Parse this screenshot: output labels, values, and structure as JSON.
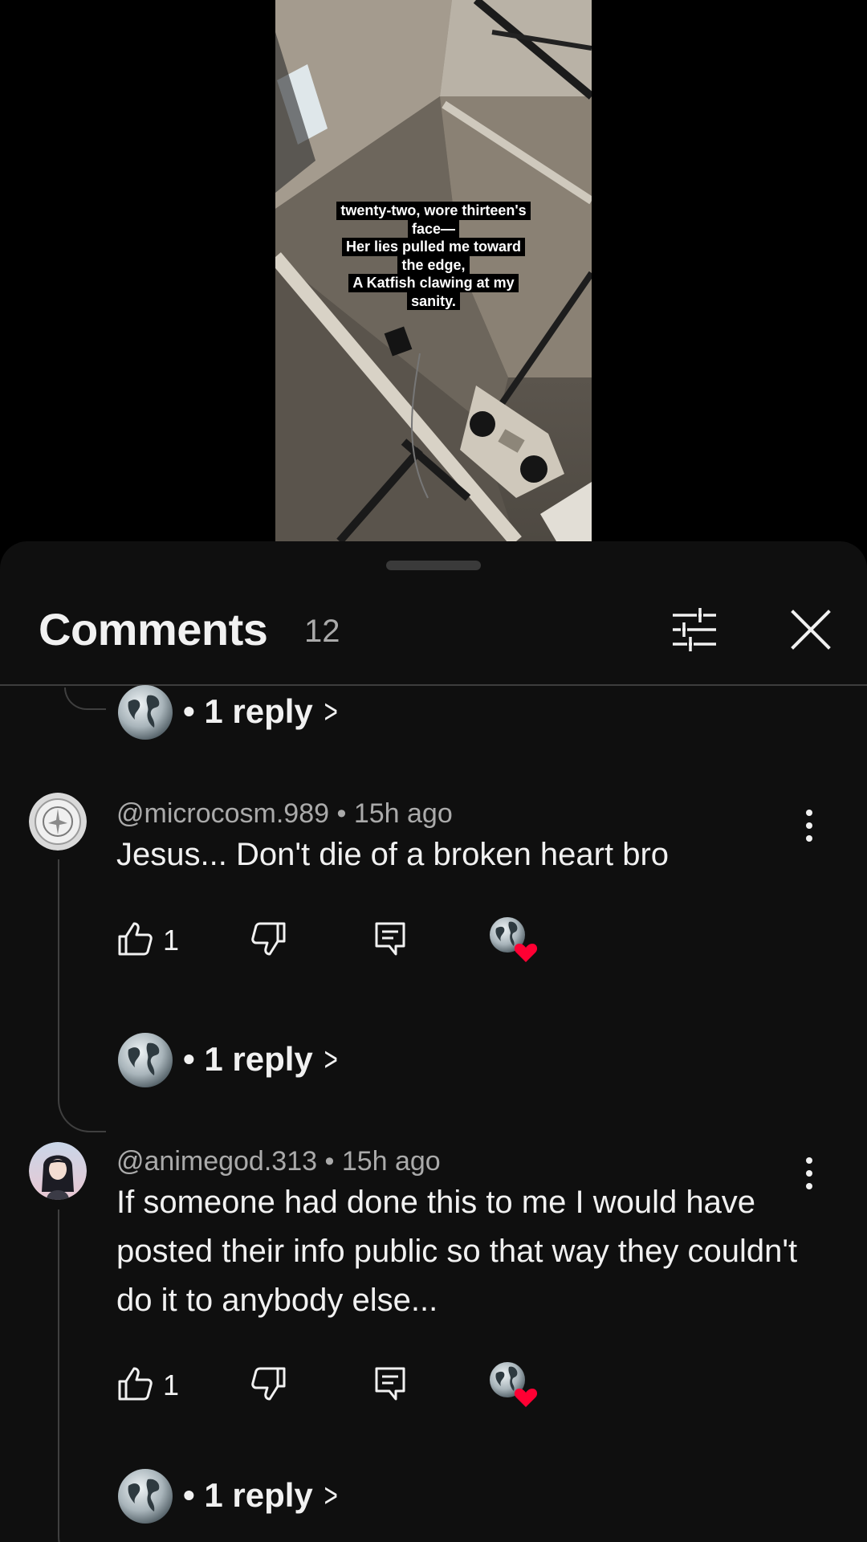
{
  "video": {
    "caption_lines": [
      "twenty-two, wore thirteen's",
      "face—",
      "Her lies pulled me toward",
      "the edge,",
      "A Katfish clawing at my",
      "sanity."
    ]
  },
  "comments_panel": {
    "title": "Comments",
    "count": "12",
    "filter_icon": "sliders-icon",
    "close_icon": "close-icon"
  },
  "reply_rows": [
    {
      "label": "• 1 reply",
      "chevron": ">"
    },
    {
      "label": "• 1 reply",
      "chevron": ">"
    },
    {
      "label": "• 1 reply",
      "chevron": ">"
    }
  ],
  "comments": [
    {
      "meta": "@microcosm.989 • 15h ago",
      "text": "Jesus... Don't die of a broken heart bro",
      "likes": "1",
      "creator_heart": true
    },
    {
      "meta": "@animegod.313 • 15h ago",
      "text": "If someone had done this to me I would have posted their info public so that way they couldn't do it to anybody else...",
      "likes": "1",
      "creator_heart": true
    }
  ],
  "colors": {
    "sheet_bg": "#0f0f0f",
    "text_primary": "#f1f1f1",
    "text_secondary": "#aaaaaa",
    "heart": "#ff0033"
  }
}
